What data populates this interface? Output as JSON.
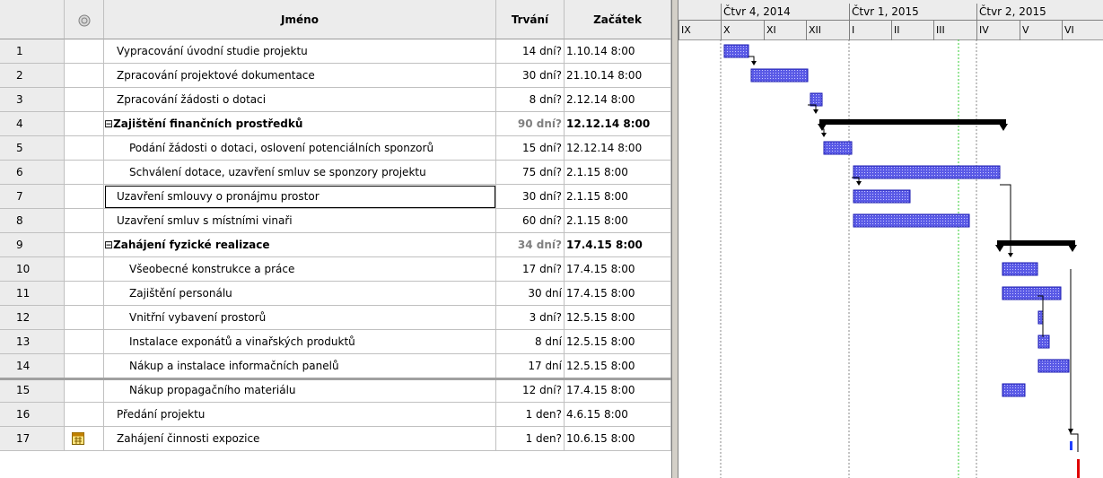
{
  "grid": {
    "headers": {
      "id": "",
      "indicators_icon": "info-circle-icon",
      "name": "Jméno",
      "duration": "Trvání",
      "start": "Začátek"
    },
    "rows": [
      {
        "id": "1",
        "name": "Vypracování úvodní studie projektu",
        "duration": "14 dní?",
        "start": "1.10.14 8:00",
        "level": 1
      },
      {
        "id": "2",
        "name": "Zpracování projektové dokumentace",
        "duration": "30 dní?",
        "start": "21.10.14 8:00",
        "level": 1
      },
      {
        "id": "3",
        "name": "Zpracování žádosti o dotaci",
        "duration": "8 dní?",
        "start": "2.12.14 8:00",
        "level": 1
      },
      {
        "id": "4",
        "name": "Zajištění finančních prostředků",
        "duration": "90 dní?",
        "start": "12.12.14 8:00",
        "level": 0,
        "summary": true
      },
      {
        "id": "5",
        "name": "Podání žádosti o dotaci, oslovení potenciálních sponzorů",
        "duration": "15 dní?",
        "start": "12.12.14 8:00",
        "level": 2
      },
      {
        "id": "6",
        "name": "Schválení dotace, uzavření smluv se sponzory projektu",
        "duration": "75 dní?",
        "start": "2.1.15 8:00",
        "level": 2
      },
      {
        "id": "7",
        "name": "Uzavření smlouvy o pronájmu prostor",
        "duration": "30 dní?",
        "start": "2.1.15 8:00",
        "level": 1,
        "selected": true
      },
      {
        "id": "8",
        "name": "Uzavření smluv s místními vinaři",
        "duration": "60 dní?",
        "start": "2.1.15 8:00",
        "level": 1
      },
      {
        "id": "9",
        "name": "Zahájení fyzické realizace",
        "duration": "34 dní?",
        "start": "17.4.15 8:00",
        "level": 0,
        "summary": true
      },
      {
        "id": "10",
        "name": "Všeobecné konstrukce a práce",
        "duration": "17 dní?",
        "start": "17.4.15 8:00",
        "level": 2
      },
      {
        "id": "11",
        "name": "Zajištění personálu",
        "duration": "30 dní",
        "start": "17.4.15 8:00",
        "level": 2
      },
      {
        "id": "12",
        "name": "Vnitřní vybavení prostorů",
        "duration": "3 dní?",
        "start": "12.5.15 8:00",
        "level": 2
      },
      {
        "id": "13",
        "name": "Instalace exponátů a vinařských produktů",
        "duration": "8 dní",
        "start": "12.5.15 8:00",
        "level": 2
      },
      {
        "id": "14",
        "name": "Nákup a instalace informačních panelů",
        "duration": "17 dní",
        "start": "12.5.15 8:00",
        "level": 2
      },
      {
        "id": "15",
        "name": "Nákup propagačního materiálu",
        "duration": "12 dní?",
        "start": "17.4.15 8:00",
        "level": 2
      },
      {
        "id": "16",
        "name": "Předání projektu",
        "duration": "1 den?",
        "start": "4.6.15 8:00",
        "level": 1
      },
      {
        "id": "17",
        "name": "Zahájení činnosti expozice",
        "duration": "1 den?",
        "start": "10.6.15 8:00",
        "level": 1,
        "indicator": "calendar-icon"
      }
    ]
  },
  "timescale": {
    "quarters": [
      "Čtvr 4, 2014",
      "Čtvr 1, 2015",
      "Čtvr 2, 2015"
    ],
    "months": [
      "IX",
      "X",
      "XI",
      "XII",
      "I",
      "II",
      "III",
      "IV",
      "V",
      "VI"
    ]
  },
  "colors": {
    "task_bar": "#5a5ae6",
    "task_bar_border": "#1a1ab0",
    "summary_bar": "#000000",
    "today_line": "#33cc33",
    "milestone_red": "#e00000",
    "header_bg": "#ececec"
  }
}
